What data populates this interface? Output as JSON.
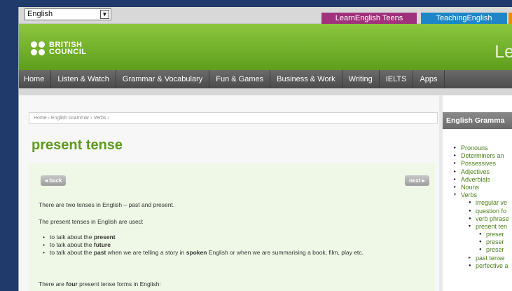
{
  "topbar": {
    "language": "English",
    "links": [
      "LearnEnglish Teens",
      "TeachingEnglish"
    ]
  },
  "header": {
    "logo_line1": "BRITISH",
    "logo_line2": "COUNCIL",
    "site_partial": "Le"
  },
  "nav": {
    "items": [
      "Home",
      "Listen & Watch",
      "Grammar & Vocabulary",
      "Fun & Games",
      "Business & Work",
      "Writing",
      "IELTS",
      "Apps"
    ]
  },
  "breadcrumb": "Home › English Grammar › Verbs ›",
  "page_title": "present tense",
  "content": {
    "back_label": "◂ back",
    "next_label": "next ▸",
    "intro": "There are two tenses in English – past and present.",
    "used_intro": "The present tenses in English are used:",
    "bullets": [
      {
        "pre": "to talk about the ",
        "bold": "present",
        "post": ""
      },
      {
        "pre": "to talk about the ",
        "bold": "future",
        "post": ""
      },
      {
        "pre": "to talk about the ",
        "bold": "past",
        "post": " when we are telling a story in ",
        "bold2": "spoken",
        "post2": " English or when we are summarising a book, film, play etc."
      }
    ],
    "forms_pre": "There are ",
    "forms_bold": "four",
    "forms_post": " present tense forms in English:"
  },
  "sidebar": {
    "heading": "English Gramma",
    "items": [
      {
        "label": "Pronouns",
        "level": 0,
        "marker": "▸"
      },
      {
        "label": "Determiners an",
        "level": 0,
        "marker": "▸"
      },
      {
        "label": "Possessives",
        "level": 0,
        "marker": "▸"
      },
      {
        "label": "Adjectives",
        "level": 0,
        "marker": "▸"
      },
      {
        "label": "Adverbials",
        "level": 0,
        "marker": "▸"
      },
      {
        "label": "Nouns",
        "level": 0,
        "marker": "▸"
      },
      {
        "label": "Verbs",
        "level": 0,
        "marker": "▾"
      },
      {
        "label": "irregular ve",
        "level": 1,
        "marker": "●"
      },
      {
        "label": "question fo",
        "level": 1,
        "marker": "●"
      },
      {
        "label": "verb phrase",
        "level": 1,
        "marker": "●"
      },
      {
        "label": "present ten",
        "level": 1,
        "marker": "▾"
      },
      {
        "label": "preser",
        "level": 2,
        "marker": "●"
      },
      {
        "label": "preser",
        "level": 2,
        "marker": "●"
      },
      {
        "label": "preser",
        "level": 2,
        "marker": "●"
      },
      {
        "label": "past tense",
        "level": 1,
        "marker": "▸"
      },
      {
        "label": "perfective a",
        "level": 1,
        "marker": "●"
      }
    ]
  }
}
